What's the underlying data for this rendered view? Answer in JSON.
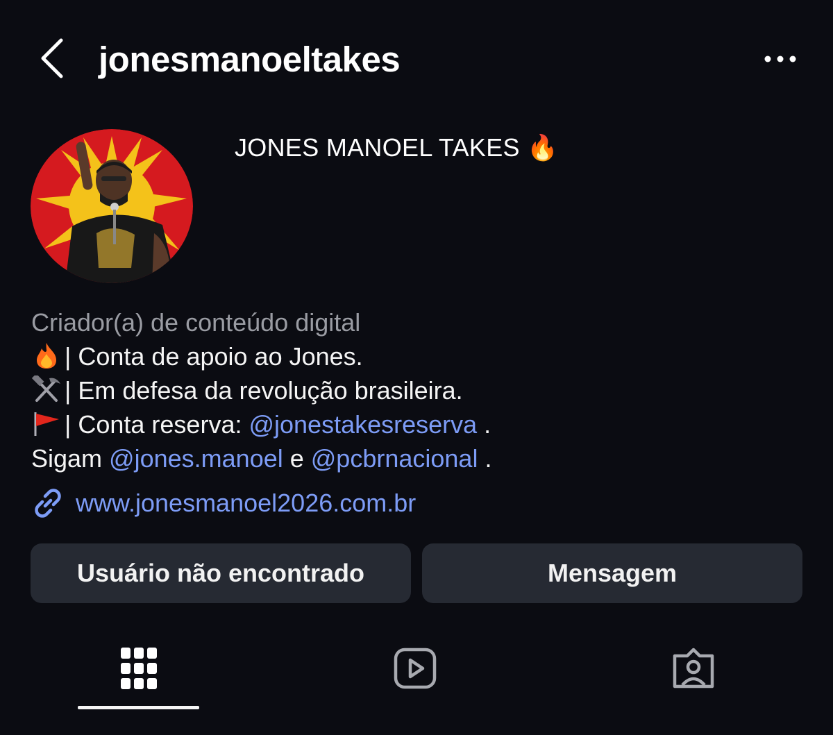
{
  "header": {
    "username": "jonesmanoeltakes"
  },
  "profile": {
    "display_name": "JONES MANOEL TAKES 🔥",
    "category": "Criador(a) de conteúdo digital",
    "bio": {
      "line1": "| Conta de apoio ao Jones.",
      "line2": "| Em defesa da revolução brasileira.",
      "line3_prefix": "| Conta reserva: ",
      "line3_mention": "@jonestakesreserva",
      "line3_suffix": " .",
      "line4_prefix": "Sigam ",
      "line4_mention1": "@jones.manoel",
      "line4_mid": " e ",
      "line4_mention2": "@pcbrnacional",
      "line4_suffix": " ."
    },
    "website": "www.jonesmanoel2026.com.br"
  },
  "buttons": {
    "user_not_found": "Usuário não encontrado",
    "message": "Mensagem"
  },
  "tabs": [
    {
      "icon": "grid-icon",
      "active": true
    },
    {
      "icon": "reels-icon",
      "active": false
    },
    {
      "icon": "tagged-icon",
      "active": false
    }
  ],
  "colors": {
    "background": "#0b0c12",
    "link": "#7d9cf6",
    "button": "#262a33",
    "category_text": "#9a9ca3"
  }
}
